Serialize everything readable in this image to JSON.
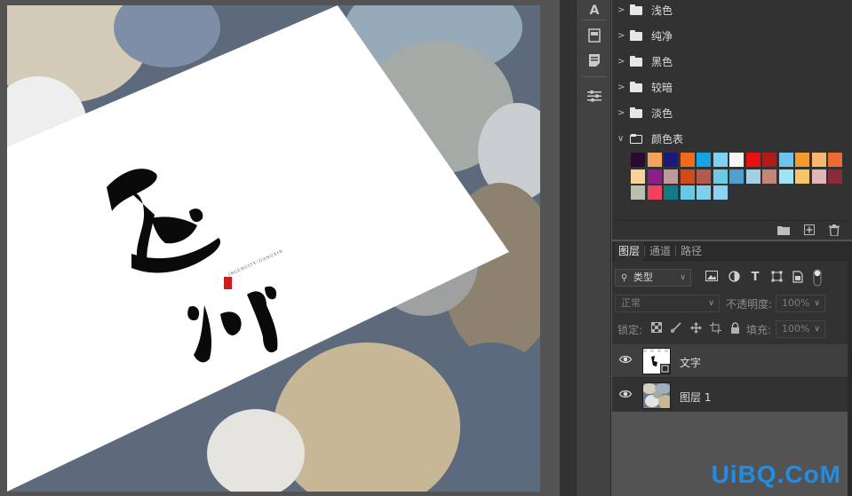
{
  "swatch_groups": [
    {
      "label": "浅色",
      "expanded": false
    },
    {
      "label": "纯净",
      "expanded": false
    },
    {
      "label": "黑色",
      "expanded": false
    },
    {
      "label": "较暗",
      "expanded": false
    },
    {
      "label": "淡色",
      "expanded": false
    },
    {
      "label": "颜色表",
      "expanded": true
    }
  ],
  "swatches": [
    "#2a0b2e",
    "#f2a35e",
    "#191a7b",
    "#f26b1d",
    "#16a3e3",
    "#7fd3f0",
    "#f5f5f5",
    "#e81010",
    "#b11a1a",
    "#6ec4ea",
    "#f59a2d",
    "#f7b86e",
    "#ee6a34",
    "#f7d29a",
    "#8e1f8a",
    "#c09a9a",
    "#d24a1a",
    "#b45a4a",
    "#6ccbe3",
    "#4f9fcf",
    "#a5cfe2",
    "#c4857a",
    "#9fe3f5",
    "#f7c469",
    "#e2b4b8",
    "#8b2a3a",
    "#b8c0b0",
    "#f2415e",
    "#127b86",
    "#66c9e6",
    "#7fd0ea",
    "#8ad4ef"
  ],
  "layers_tabs": [
    "图层",
    "通道",
    "路径"
  ],
  "filter": {
    "kind": "类型"
  },
  "blend_mode": "正常",
  "opacity": {
    "label": "不透明度:",
    "value": "100%"
  },
  "lock": {
    "label": "锁定:"
  },
  "fill": {
    "label": "填充:",
    "value": "100%"
  },
  "layers": [
    {
      "name": "文字",
      "visible": true,
      "selected": true
    },
    {
      "name": "图层 1",
      "visible": true,
      "selected": false
    }
  ],
  "artwork_text": "INGENUITY/JIANGXIN",
  "watermark": "UiBQ.CoM"
}
